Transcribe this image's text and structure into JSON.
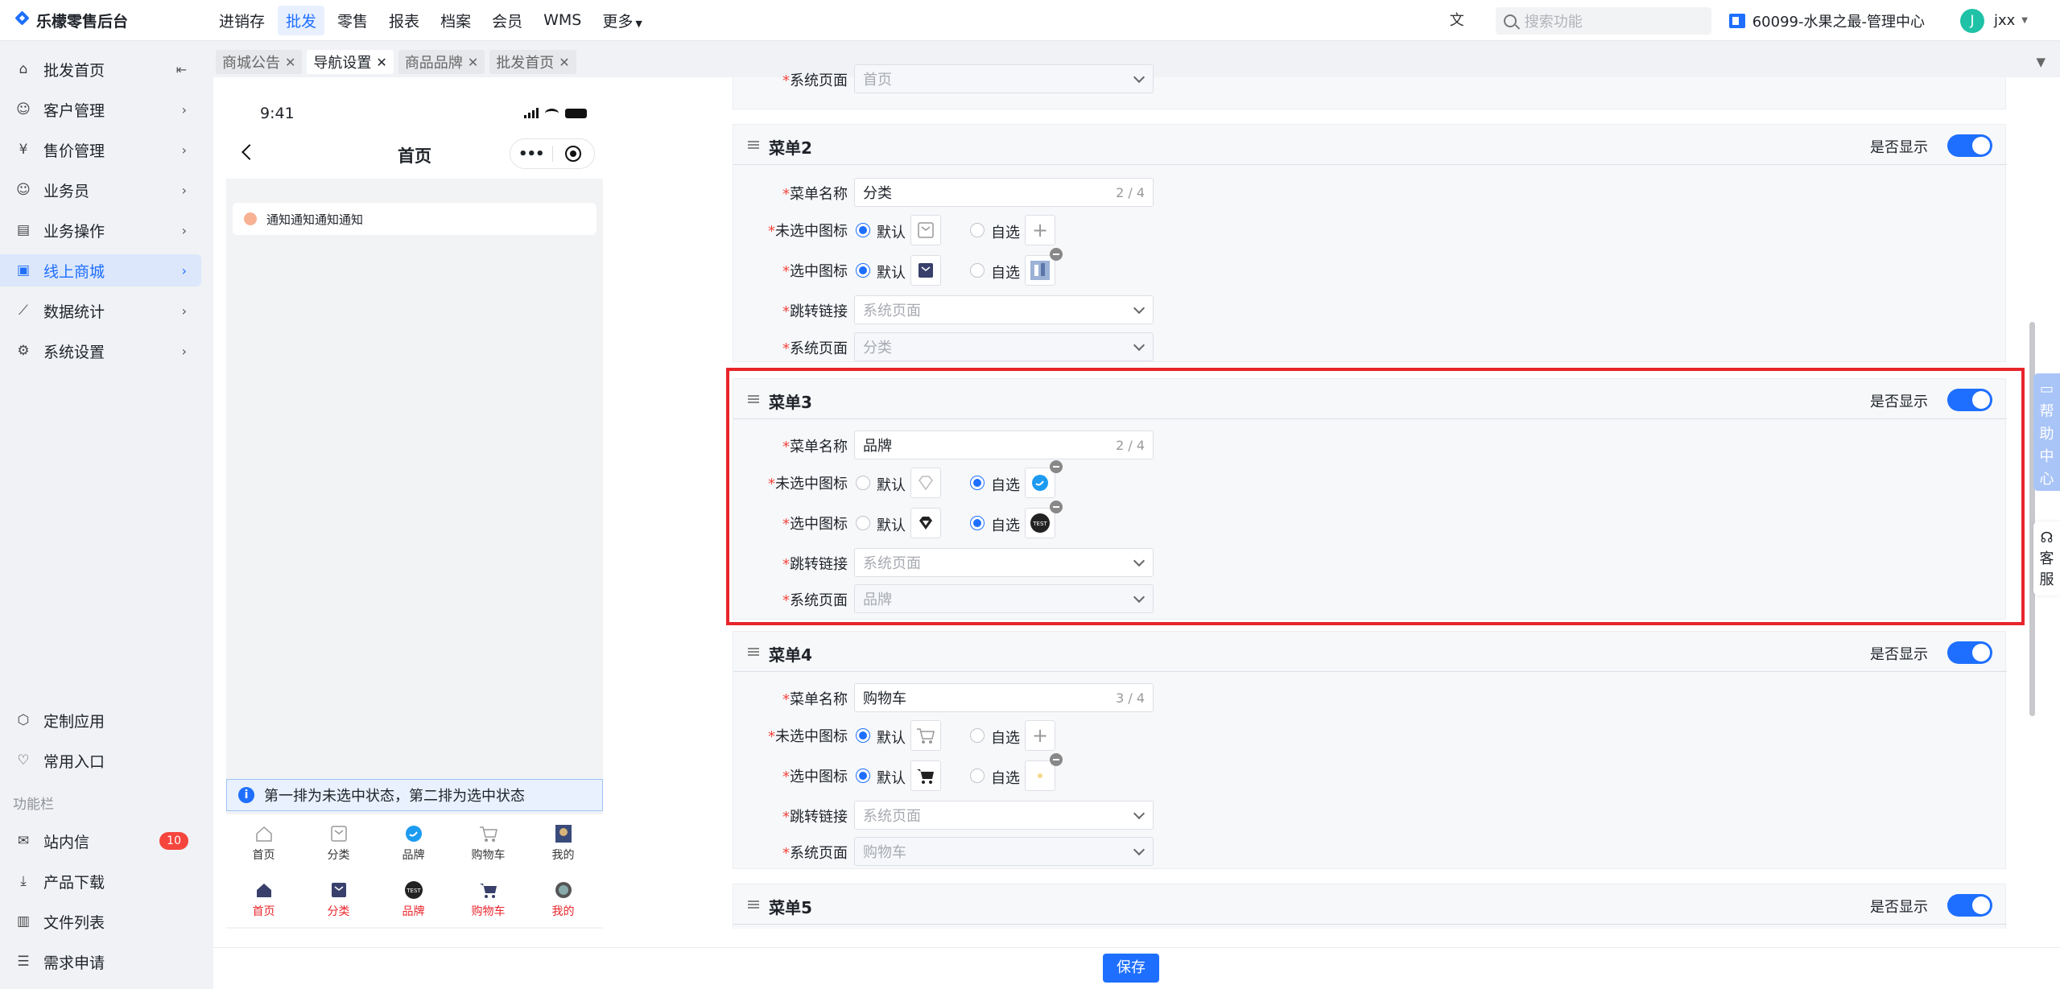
{
  "brand": {
    "name": "乐檬零售后台"
  },
  "nav": {
    "items": [
      "进销存",
      "批发",
      "零售",
      "报表",
      "档案",
      "会员",
      "WMS",
      "更多"
    ],
    "active": "批发"
  },
  "header": {
    "search_placeholder": "搜索功能",
    "store": "60099-水果之最-管理中心",
    "user": "jxx",
    "avatar_letter": "J"
  },
  "sidebar": {
    "items": [
      {
        "label": "批发首页",
        "icon": "home-icon"
      },
      {
        "label": "客户管理",
        "icon": "user-icon"
      },
      {
        "label": "售价管理",
        "icon": "yen-icon"
      },
      {
        "label": "业务员",
        "icon": "person-icon"
      },
      {
        "label": "业务操作",
        "icon": "server-icon"
      },
      {
        "label": "线上商城",
        "icon": "shop-icon"
      },
      {
        "label": "数据统计",
        "icon": "chart-icon"
      },
      {
        "label": "系统设置",
        "icon": "gear-icon"
      }
    ],
    "bottom": [
      {
        "label": "定制应用",
        "icon": "cube-icon"
      },
      {
        "label": "常用入口",
        "icon": "heart-icon"
      }
    ],
    "section": "功能栏",
    "tools": [
      {
        "label": "站内信",
        "icon": "mail-icon",
        "badge": "10"
      },
      {
        "label": "产品下载",
        "icon": "download-icon"
      },
      {
        "label": "文件列表",
        "icon": "file-icon"
      },
      {
        "label": "需求申请",
        "icon": "request-icon"
      }
    ]
  },
  "tabs": [
    {
      "label": "商城公告"
    },
    {
      "label": "导航设置"
    },
    {
      "label": "商品品牌"
    },
    {
      "label": "批发首页"
    }
  ],
  "phone": {
    "time": "9:41",
    "title": "首页",
    "notice": "通知通知通知通知",
    "tip": "第一排为未选中状态，第二排为选中状态",
    "tabbar": [
      "首页",
      "分类",
      "品牌",
      "购物车",
      "我的"
    ]
  },
  "form": {
    "labels": {
      "name": "菜单名称",
      "unselected": "未选中图标",
      "selected": "选中图标",
      "link": "跳转链接",
      "page": "系统页面",
      "default": "默认",
      "custom": "自选",
      "show": "是否显示",
      "link_placeholder": "系统页面"
    },
    "top_page": "首页",
    "menus": [
      {
        "title": "菜单2",
        "name": "分类",
        "count": "2 / 4",
        "page": "分类"
      },
      {
        "title": "菜单3",
        "name": "品牌",
        "count": "2 / 4",
        "page": "品牌"
      },
      {
        "title": "菜单4",
        "name": "购物车",
        "count": "3 / 4",
        "page": "购物车"
      },
      {
        "title": "菜单5"
      }
    ]
  },
  "actions": {
    "save": "保存"
  },
  "help": {
    "chars": [
      "帮",
      "助",
      "中",
      "心"
    ],
    "kefu": [
      "客",
      "服"
    ]
  }
}
